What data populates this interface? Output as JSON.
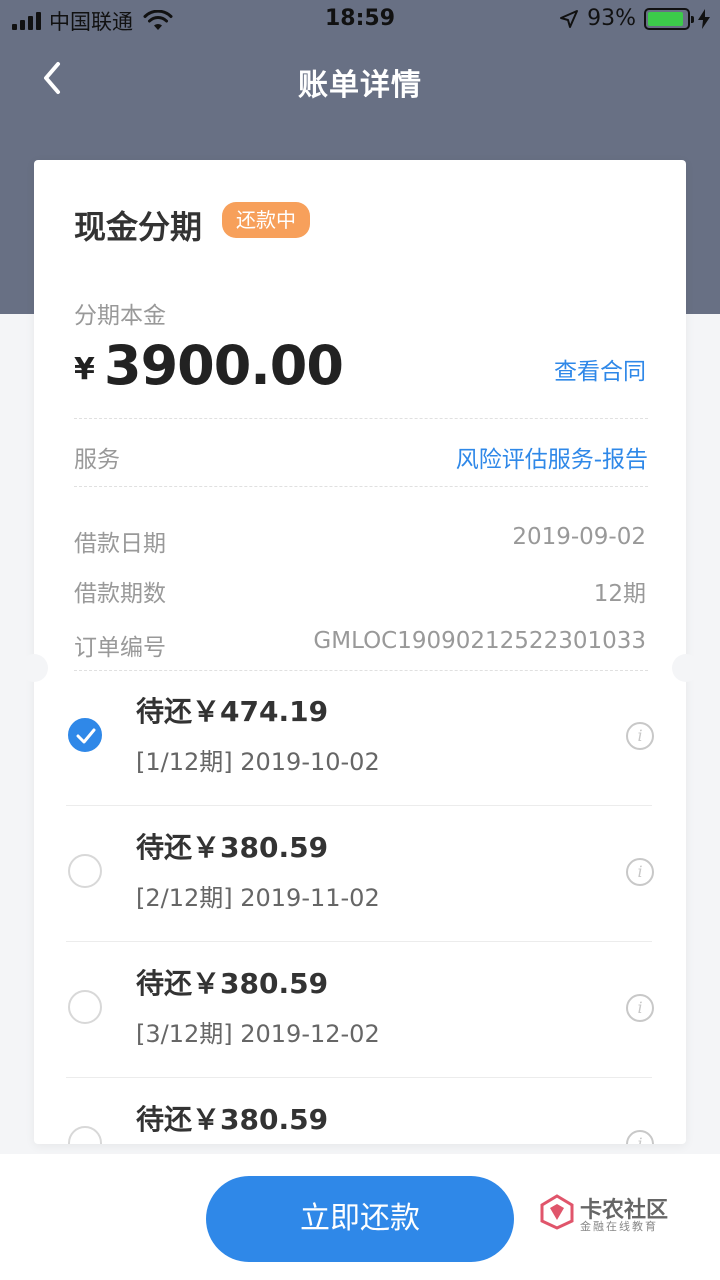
{
  "status": {
    "carrier": "中国联通",
    "time": "18:59",
    "battery": "93%",
    "battery_level": 0.93
  },
  "nav": {
    "title": "账单详情"
  },
  "loan": {
    "product": "现金分期",
    "status_badge": "还款中",
    "principal_label": "分期本金",
    "currency": "¥",
    "principal": "3900.00",
    "contract_link": "查看合同",
    "service_label": "服务",
    "service_link": "风险评估服务-报告",
    "date_label": "借款日期",
    "date": "2019-09-02",
    "periods_label": "借款期数",
    "periods": "12期",
    "order_label": "订单编号",
    "order_no": "GMLOC19090212522301033"
  },
  "installments": [
    {
      "amount": "待还￥474.19",
      "period": "[1/12期] 2019-10-02",
      "checked": true
    },
    {
      "amount": "待还￥380.59",
      "period": "[2/12期] 2019-11-02",
      "checked": false
    },
    {
      "amount": "待还￥380.59",
      "period": "[3/12期] 2019-12-02",
      "checked": false
    },
    {
      "amount": "待还￥380.59",
      "period": "",
      "checked": false
    }
  ],
  "footer": {
    "pay_button": "立即还款",
    "watermark_name": "卡农社区",
    "watermark_sub": "金融在线教育"
  },
  "colors": {
    "header": "#687084",
    "accent": "#2f88e8",
    "badge": "#f7a05b"
  }
}
